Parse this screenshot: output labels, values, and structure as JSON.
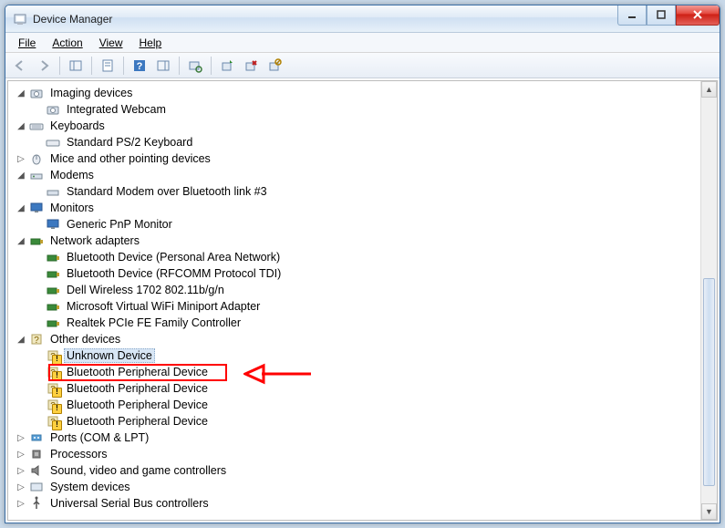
{
  "window": {
    "title": "Device Manager"
  },
  "menubar": {
    "items": [
      "File",
      "Action",
      "View",
      "Help"
    ]
  },
  "toolbar": {
    "back": "back-icon",
    "forward": "forward-icon",
    "show_hide": "show-hide-tree-icon",
    "properties": "properties-icon",
    "help": "help-icon",
    "action": "action-icon",
    "scan": "scan-hardware-icon",
    "update": "update-driver-icon",
    "uninstall": "uninstall-icon",
    "disable": "disable-icon"
  },
  "tree": {
    "imaging": {
      "label": "Imaging devices",
      "children": [
        "Integrated Webcam"
      ]
    },
    "keyboards": {
      "label": "Keyboards",
      "children": [
        "Standard PS/2 Keyboard"
      ]
    },
    "mice": {
      "label": "Mice and other pointing devices"
    },
    "modems": {
      "label": "Modems",
      "children": [
        "Standard Modem over Bluetooth link #3"
      ]
    },
    "monitors": {
      "label": "Monitors",
      "children": [
        "Generic PnP Monitor"
      ]
    },
    "network": {
      "label": "Network adapters",
      "children": [
        "Bluetooth Device (Personal Area Network)",
        "Bluetooth Device (RFCOMM Protocol TDI)",
        "Dell Wireless 1702 802.11b/g/n",
        "Microsoft Virtual WiFi Miniport Adapter",
        "Realtek PCIe FE Family Controller"
      ]
    },
    "other": {
      "label": "Other devices",
      "children": [
        "Unknown Device",
        "Bluetooth Peripheral Device",
        "Bluetooth Peripheral Device",
        "Bluetooth Peripheral Device",
        "Bluetooth Peripheral Device"
      ]
    },
    "ports": {
      "label": "Ports (COM & LPT)"
    },
    "processors": {
      "label": "Processors"
    },
    "sound": {
      "label": "Sound, video and game controllers"
    },
    "system": {
      "label": "System devices"
    },
    "usb": {
      "label": "Universal Serial Bus controllers"
    }
  },
  "annotation": {
    "highlighted_item": "Unknown Device"
  }
}
